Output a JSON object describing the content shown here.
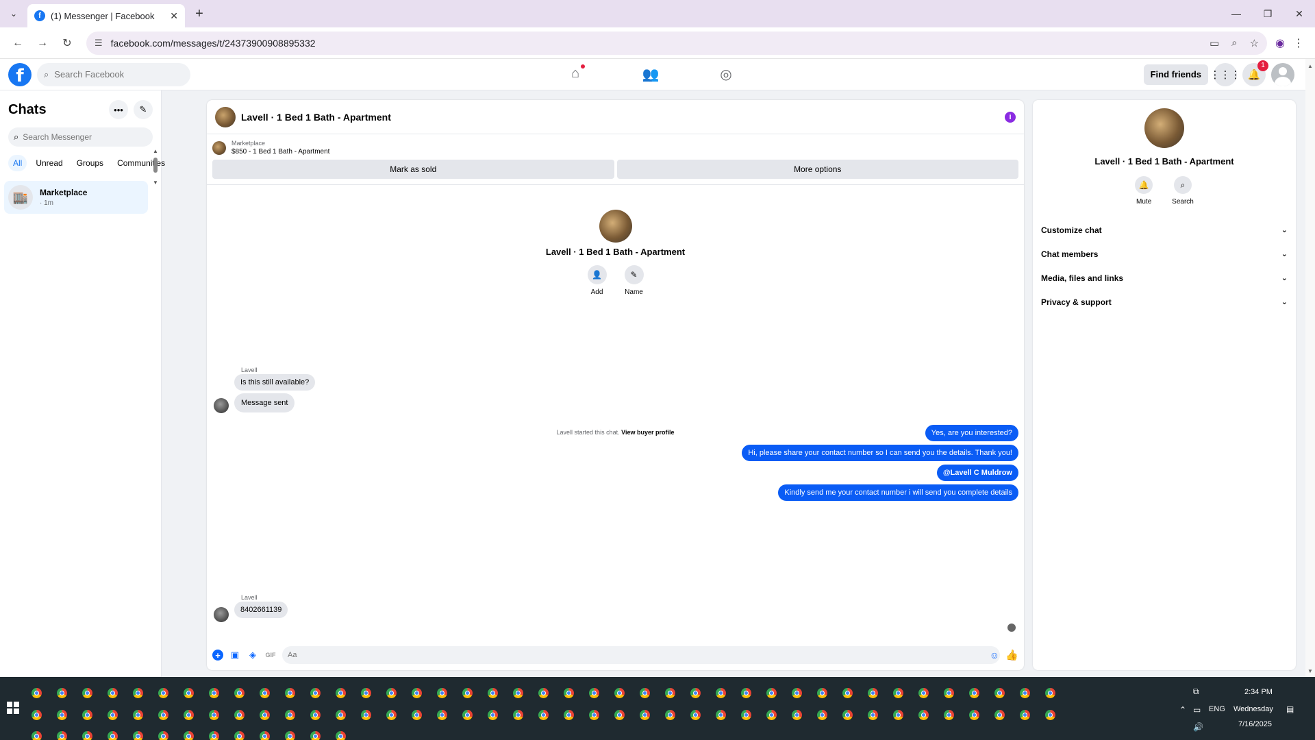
{
  "browser": {
    "tab_title": "(1) Messenger | Facebook",
    "url": "facebook.com/messages/t/24373900908895332"
  },
  "fb": {
    "search_placeholder": "Search Facebook",
    "find_friends": "Find friends",
    "notification_count": "1"
  },
  "chats": {
    "title": "Chats",
    "search_placeholder": "Search Messenger",
    "filters": [
      "All",
      "Unread",
      "Groups",
      "Communities"
    ],
    "items": [
      {
        "name": "Marketplace",
        "time": "· 1m"
      }
    ]
  },
  "conversation": {
    "title": "Lavell · 1 Bed 1 Bath - Apartment",
    "marketplace_label": "Marketplace",
    "listing": "$850 - 1 Bed 1 Bath - Apartment",
    "mark_sold": "Mark as sold",
    "more_options": "More options",
    "center_name": "Lavell · 1 Bed 1 Bath - Apartment",
    "add_label": "Add",
    "name_label": "Name",
    "system_note": "Lavell started this chat.",
    "system_link": "View buyer profile",
    "messages": [
      {
        "from": "Lavell",
        "dir": "in",
        "text": "Is this still available?"
      },
      {
        "from": "Lavell",
        "dir": "in",
        "text": "Message sent"
      },
      {
        "from": "me",
        "dir": "out",
        "text": "Yes, are you interested?"
      },
      {
        "from": "me",
        "dir": "out",
        "text": "Hi, please share your contact number so I can send you the details. Thank you!"
      },
      {
        "from": "me",
        "dir": "out",
        "text": "@Lavell C Muldrow"
      },
      {
        "from": "me",
        "dir": "out",
        "text": "Kindly send me your contact number i will send you complete details"
      },
      {
        "from": "Lavell",
        "dir": "in",
        "text": "8402661139"
      }
    ],
    "composer_placeholder": "Aa"
  },
  "info": {
    "name": "Lavell · 1 Bed 1 Bath - Apartment",
    "mute": "Mute",
    "search": "Search",
    "sections": [
      "Customize chat",
      "Chat members",
      "Media, files and links",
      "Privacy & support"
    ]
  },
  "taskbar": {
    "time": "2:34 PM",
    "day": "Wednesday",
    "date": "7/16/2025",
    "lang": "ENG"
  },
  "colors": {
    "fb_blue": "#1877f2",
    "outgoing_bubble": "#0a5cf5",
    "info_icon": "#8a2be2"
  }
}
